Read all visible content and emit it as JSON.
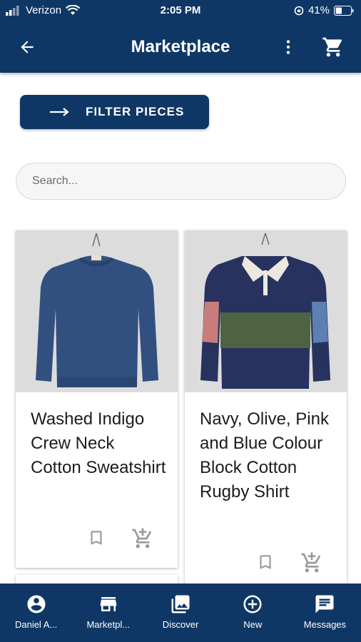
{
  "status_bar": {
    "carrier": "Verizon",
    "time": "2:05 PM",
    "battery": "41%"
  },
  "app_bar": {
    "title": "Marketplace"
  },
  "filter_button": {
    "label": "FILTER PIECES"
  },
  "search": {
    "placeholder": "Search...",
    "value": ""
  },
  "products": [
    {
      "name": "Washed Indigo Crew Neck Cotton Sweatshirt"
    },
    {
      "name": "Navy, Olive, Pink and Blue Colour Block Cotton Rugby Shirt"
    }
  ],
  "bottom_nav": [
    {
      "label": "Daniel A...",
      "icon": "account-circle-icon"
    },
    {
      "label": "Marketpl...",
      "icon": "store-icon"
    },
    {
      "label": "Discover",
      "icon": "image-gallery-icon"
    },
    {
      "label": "New",
      "icon": "add-circle-icon"
    },
    {
      "label": "Messages",
      "icon": "chat-icon"
    }
  ],
  "colors": {
    "primary": "#0f3766",
    "card_image_bg": "#dcdcdd"
  }
}
